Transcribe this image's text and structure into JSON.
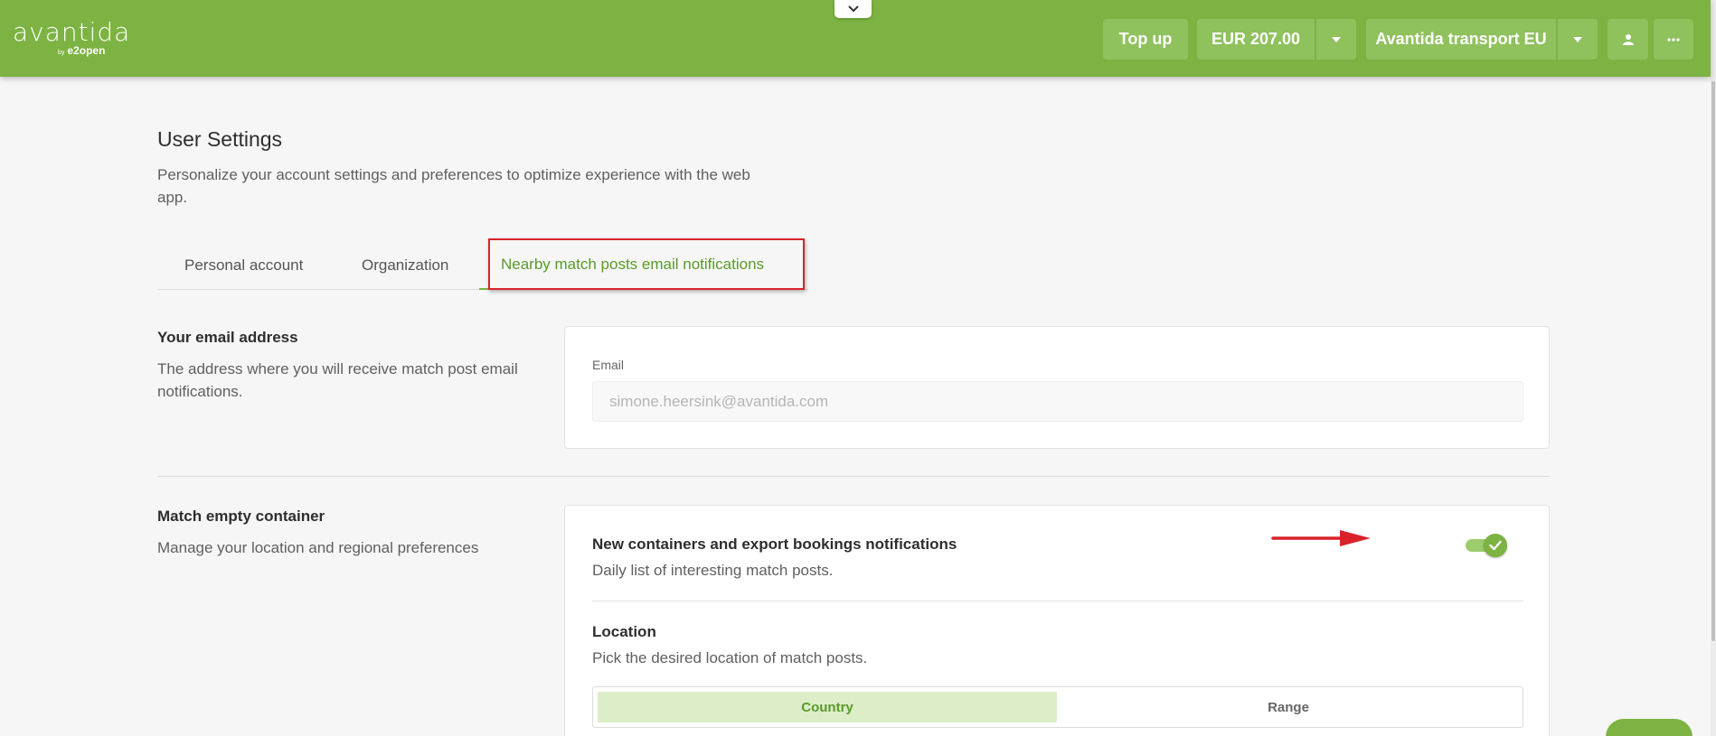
{
  "header": {
    "logo_text": "avantida",
    "logo_by": "by",
    "logo_sub": "e2open",
    "topup_label": "Top up",
    "balance_label": "EUR 207.00",
    "company_label": "Avantida transport EU"
  },
  "page": {
    "title": "User Settings",
    "description": "Personalize your account settings and preferences to optimize experience with the web app."
  },
  "tabs": [
    {
      "label": "Personal account"
    },
    {
      "label": "Organization"
    },
    {
      "label": "Nearby match posts email notifications"
    }
  ],
  "email_section": {
    "title": "Your email address",
    "description": "The address where you will receive match post email notifications.",
    "field_label": "Email",
    "field_value": "simone.heersink@avantida.com"
  },
  "match_section": {
    "title": "Match empty container",
    "description": "Manage your location and regional preferences",
    "notification_title": "New containers and export bookings notifications",
    "notification_desc": "Daily list of interesting match posts.",
    "toggle_on": true,
    "location_title": "Location",
    "location_desc": "Pick the desired location of match posts.",
    "location_options": [
      "Country",
      "Range"
    ],
    "location_selected": "Country"
  },
  "colors": {
    "brand_green": "#7cb342",
    "annotation_red": "#d9232a"
  }
}
